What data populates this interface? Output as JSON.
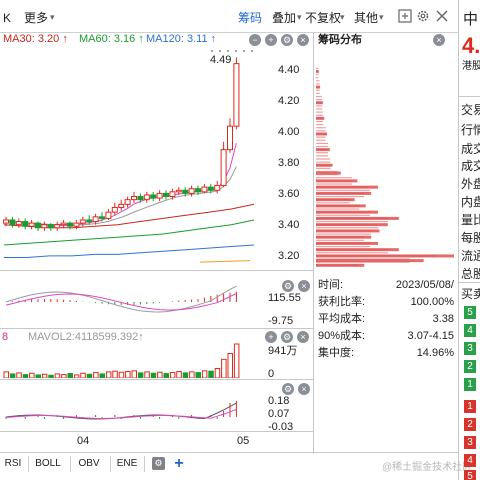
{
  "toolbar": {
    "left_label": "K",
    "more_label": "更多",
    "chip_label": "筹码",
    "overlay_label": "叠加",
    "adjust_label": "不复权",
    "other_label": "其他"
  },
  "ma_legend": [
    {
      "label": "MA30: 3.20",
      "color": "#c4281c"
    },
    {
      "label": "MA60: 3.16",
      "color": "#1a9c2f"
    },
    {
      "label": "MA120: 3.11",
      "color": "#2d74d6"
    }
  ],
  "chart_data": {
    "type": "candlestick",
    "price_axis_ticks": [
      "4.40",
      "4.20",
      "4.00",
      "3.80",
      "3.60",
      "3.40",
      "3.20"
    ],
    "ylim": [
      3.13,
      4.55
    ],
    "high_marker": "4.49",
    "x_ticks": [
      "04",
      "05"
    ],
    "ma_lines": [
      {
        "name": "MA30",
        "color": "#c4281c",
        "values": [
          3.42,
          3.41,
          3.4,
          3.4,
          3.41,
          3.42,
          3.44,
          3.46,
          3.48,
          3.5,
          3.52,
          3.55
        ]
      },
      {
        "name": "MA60",
        "color": "#1a9c2f",
        "values": [
          3.29,
          3.3,
          3.31,
          3.32,
          3.33,
          3.34,
          3.35,
          3.36,
          3.38,
          3.4,
          3.42,
          3.45
        ]
      },
      {
        "name": "MA120",
        "color": "#2d74d6",
        "values": [
          3.21,
          3.21,
          3.22,
          3.22,
          3.23,
          3.23,
          3.24,
          3.25,
          3.26,
          3.27,
          3.28,
          3.29
        ]
      }
    ],
    "candles": [
      {
        "o": 3.43,
        "c": 3.45,
        "h": 3.47,
        "l": 3.41
      },
      {
        "o": 3.45,
        "c": 3.42,
        "h": 3.47,
        "l": 3.4
      },
      {
        "o": 3.42,
        "c": 3.44,
        "h": 3.46,
        "l": 3.4
      },
      {
        "o": 3.44,
        "c": 3.41,
        "h": 3.46,
        "l": 3.39
      },
      {
        "o": 3.41,
        "c": 3.43,
        "h": 3.45,
        "l": 3.39
      },
      {
        "o": 3.43,
        "c": 3.4,
        "h": 3.44,
        "l": 3.38
      },
      {
        "o": 3.4,
        "c": 3.42,
        "h": 3.44,
        "l": 3.38
      },
      {
        "o": 3.42,
        "c": 3.4,
        "h": 3.43,
        "l": 3.38
      },
      {
        "o": 3.4,
        "c": 3.42,
        "h": 3.44,
        "l": 3.38
      },
      {
        "o": 3.42,
        "c": 3.43,
        "h": 3.45,
        "l": 3.4
      },
      {
        "o": 3.43,
        "c": 3.41,
        "h": 3.44,
        "l": 3.39
      },
      {
        "o": 3.41,
        "c": 3.43,
        "h": 3.45,
        "l": 3.39
      },
      {
        "o": 3.43,
        "c": 3.45,
        "h": 3.47,
        "l": 3.41
      },
      {
        "o": 3.45,
        "c": 3.44,
        "h": 3.48,
        "l": 3.42
      },
      {
        "o": 3.44,
        "c": 3.47,
        "h": 3.49,
        "l": 3.42
      },
      {
        "o": 3.47,
        "c": 3.46,
        "h": 3.5,
        "l": 3.44
      },
      {
        "o": 3.46,
        "c": 3.5,
        "h": 3.52,
        "l": 3.45
      },
      {
        "o": 3.5,
        "c": 3.53,
        "h": 3.56,
        "l": 3.48
      },
      {
        "o": 3.53,
        "c": 3.55,
        "h": 3.58,
        "l": 3.51
      },
      {
        "o": 3.55,
        "c": 3.58,
        "h": 3.6,
        "l": 3.53
      },
      {
        "o": 3.58,
        "c": 3.6,
        "h": 3.63,
        "l": 3.56
      },
      {
        "o": 3.6,
        "c": 3.58,
        "h": 3.62,
        "l": 3.56
      },
      {
        "o": 3.58,
        "c": 3.61,
        "h": 3.63,
        "l": 3.56
      },
      {
        "o": 3.61,
        "c": 3.59,
        "h": 3.63,
        "l": 3.57
      },
      {
        "o": 3.59,
        "c": 3.62,
        "h": 3.64,
        "l": 3.57
      },
      {
        "o": 3.62,
        "c": 3.6,
        "h": 3.64,
        "l": 3.58
      },
      {
        "o": 3.6,
        "c": 3.63,
        "h": 3.65,
        "l": 3.58
      },
      {
        "o": 3.63,
        "c": 3.64,
        "h": 3.66,
        "l": 3.61
      },
      {
        "o": 3.64,
        "c": 3.62,
        "h": 3.66,
        "l": 3.6
      },
      {
        "o": 3.62,
        "c": 3.65,
        "h": 3.67,
        "l": 3.6
      },
      {
        "o": 3.65,
        "c": 3.63,
        "h": 3.67,
        "l": 3.61
      },
      {
        "o": 3.63,
        "c": 3.66,
        "h": 3.68,
        "l": 3.62
      },
      {
        "o": 3.66,
        "c": 3.64,
        "h": 3.68,
        "l": 3.62
      },
      {
        "o": 3.64,
        "c": 3.67,
        "h": 3.7,
        "l": 3.62
      },
      {
        "o": 3.67,
        "c": 3.9,
        "h": 3.95,
        "l": 3.66
      },
      {
        "o": 3.9,
        "c": 4.05,
        "h": 4.1,
        "l": 3.88
      },
      {
        "o": 4.05,
        "c": 4.45,
        "h": 4.49,
        "l": 4.03
      }
    ],
    "chip_distribution": [
      {
        "price": 4.4,
        "w": 0.02
      },
      {
        "price": 4.3,
        "w": 0.03
      },
      {
        "price": 4.2,
        "w": 0.05
      },
      {
        "price": 4.1,
        "w": 0.06
      },
      {
        "price": 4.0,
        "w": 0.08
      },
      {
        "price": 3.9,
        "w": 0.1
      },
      {
        "price": 3.8,
        "w": 0.12
      },
      {
        "price": 3.75,
        "w": 0.18
      },
      {
        "price": 3.7,
        "w": 0.3
      },
      {
        "price": 3.66,
        "w": 0.45
      },
      {
        "price": 3.62,
        "w": 0.4
      },
      {
        "price": 3.58,
        "w": 0.28
      },
      {
        "price": 3.54,
        "w": 0.36
      },
      {
        "price": 3.5,
        "w": 0.45
      },
      {
        "price": 3.46,
        "w": 0.6
      },
      {
        "price": 3.42,
        "w": 0.52
      },
      {
        "price": 3.38,
        "w": 0.46
      },
      {
        "price": 3.34,
        "w": 0.4
      },
      {
        "price": 3.3,
        "w": 0.45
      },
      {
        "price": 3.26,
        "w": 0.6
      },
      {
        "price": 3.22,
        "w": 1.0
      },
      {
        "price": 3.19,
        "w": 0.78
      },
      {
        "price": 3.16,
        "w": 0.35
      }
    ],
    "macd_axis": [
      "115.55",
      "-9.75"
    ],
    "vol_axis": [
      "941万",
      "0"
    ],
    "vol_bars": [
      0.18,
      0.12,
      0.15,
      0.1,
      0.14,
      0.09,
      0.11,
      0.08,
      0.12,
      0.1,
      0.13,
      0.09,
      0.14,
      0.11,
      0.16,
      0.12,
      0.18,
      0.2,
      0.17,
      0.19,
      0.21,
      0.15,
      0.18,
      0.14,
      0.17,
      0.13,
      0.16,
      0.19,
      0.15,
      0.18,
      0.16,
      0.21,
      0.2,
      0.28,
      0.55,
      0.72,
      1.0
    ],
    "ind3_axis": [
      "0.18",
      "0.07",
      "-0.03"
    ]
  },
  "mavol_label": "MAVOL2:4118599.392",
  "mavol_prefix": "8",
  "chip_panel": {
    "title": "筹码分布",
    "rows": [
      {
        "label": "时间:",
        "value": "2023/05/08/"
      },
      {
        "label": "获利比率:",
        "value": "100.00%"
      },
      {
        "label": "平均成本:",
        "value": "3.38"
      },
      {
        "label": "90%成本:",
        "value": "3.07-4.15"
      },
      {
        "label": "集中度:",
        "value": "14.96%"
      }
    ]
  },
  "indicator_tabs": [
    "RSI",
    "BOLL",
    "OBV",
    "ENE",
    "+"
  ],
  "right_panel": {
    "stock_char": "中",
    "price_partial": "4.",
    "hk_label": "港股",
    "labels": [
      "交易",
      "行情",
      "成交",
      "成交",
      "外盘",
      "内盘",
      "量比",
      "每股",
      "流通",
      "总股"
    ],
    "buy_sell_label": "买卖",
    "green_nums": [
      "5",
      "4",
      "3",
      "2",
      "1"
    ],
    "red_nums": [
      "1",
      "2",
      "3",
      "4",
      "5"
    ]
  },
  "watermark": "@稀土掘金技术社区"
}
